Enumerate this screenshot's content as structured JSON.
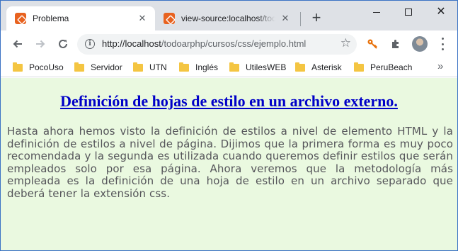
{
  "tabs": [
    {
      "title": "Problema",
      "active": true
    },
    {
      "title": "view-source:localhost/todoarphp/cursos/css/ejemplo.html",
      "active": false
    }
  ],
  "new_tab_icon": "plus-icon",
  "window_controls": [
    "minimize-icon",
    "maximize-icon",
    "close-icon"
  ],
  "toolbar": {
    "back_icon": "arrow-left-icon",
    "forward_icon": "arrow-right-icon",
    "reload_icon": "reload-icon",
    "url_host": "http://localhost",
    "url_path": "/todoarphp/cursos/css/ejemplo.html",
    "bookmark_star_icon": "star-icon",
    "extensions": [
      "key-icon",
      "puzzle-icon"
    ],
    "profile": "avatar",
    "menu_icon": "more-vert-icon"
  },
  "bookmarks": [
    "PocoUso",
    "Servidor",
    "UTN",
    "Inglés",
    "UtilesWEB",
    "Asterisk",
    "PeruBeach"
  ],
  "bookmarks_overflow": "»",
  "colors": {
    "page_background": "#eaf9e0",
    "heading": "#0000c8",
    "paragraph": "#55555a",
    "tab_strip": "#dee1e6",
    "favicon": "#e8621f"
  },
  "page": {
    "heading": "Definición de hojas de estilo en un archivo externo.",
    "paragraph": "Hasta ahora hemos visto la definición de estilos a nivel de elemento HTML y la definición de estilos a nivel de página. Dijimos que la primera forma es muy poco recomendada y la segunda es utilizada cuando queremos definir estilos que serán empleados solo por esa página. Ahora veremos que la metodología más empleada es la definición de una hoja de estilo en un archivo separado que deberá tener la extensión css."
  }
}
